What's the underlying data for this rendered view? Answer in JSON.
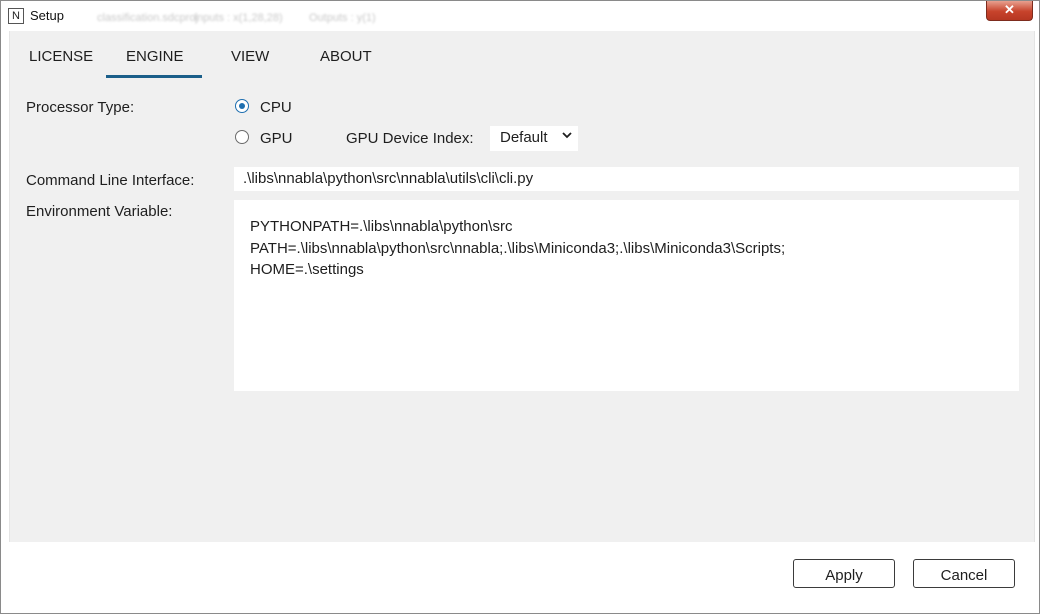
{
  "window": {
    "title": "Setup",
    "app_icon_letter": "N",
    "close_glyph": "✕",
    "background_text": [
      "classification.sdcproj",
      "Inputs : x(1,28,28)",
      "Outputs : y(1)"
    ]
  },
  "tabs": [
    {
      "label": "LICENSE",
      "selected": false
    },
    {
      "label": "ENGINE",
      "selected": true
    },
    {
      "label": "VIEW",
      "selected": false
    },
    {
      "label": "ABOUT",
      "selected": false
    }
  ],
  "engine": {
    "processor_type_label": "Processor Type:",
    "cpu_label": "CPU",
    "gpu_label": "GPU",
    "selected_processor": "CPU",
    "gpu_device_index_label": "GPU Device Index:",
    "gpu_device_index_value": "Default",
    "cli_label": "Command Line Interface:",
    "cli_value": ".\\libs\\nnabla\\python\\src\\nnabla\\utils\\cli\\cli.py",
    "env_label": "Environment Variable:",
    "env_lines": [
      "PYTHONPATH=.\\libs\\nnabla\\python\\src",
      "PATH=.\\libs\\nnabla\\python\\src\\nnabla;.\\libs\\Miniconda3;.\\libs\\Miniconda3\\Scripts;",
      "HOME=.\\settings"
    ]
  },
  "footer": {
    "apply_label": "Apply",
    "cancel_label": "Cancel"
  },
  "colors": {
    "accent": "#1b5f8a",
    "radio_selected": "#1e6fb0",
    "client_bg": "#f0f0f0",
    "close_button": "#c7432b"
  }
}
